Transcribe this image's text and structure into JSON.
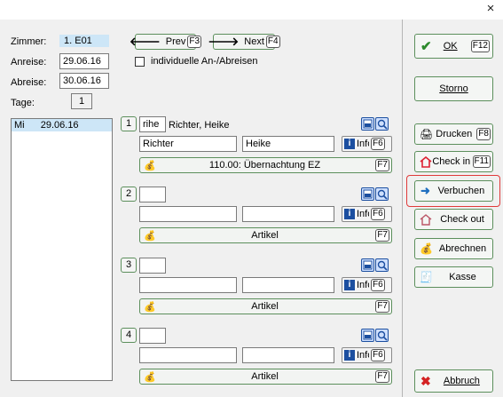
{
  "window": {
    "close_glyph": "×"
  },
  "header": {
    "zimmer_label": "Zimmer:",
    "zimmer_value": "1. E01",
    "anreise_label": "Anreise:",
    "anreise_value": "29.06.16",
    "abreise_label": "Abreise:",
    "abreise_value": "30.06.16",
    "tage_label": "Tage:",
    "tage_value": "1",
    "prev_label": "Prev",
    "prev_key": "F3",
    "next_label": "Next",
    "next_key": "F4",
    "individual_label": "individuelle An-/Abreisen"
  },
  "day_list": [
    {
      "day": "Mi",
      "date": "29.06.16"
    }
  ],
  "guests": [
    {
      "num": "1",
      "short": "rihe",
      "display": "Richter, Heike",
      "last": "Richter",
      "first": "Heike",
      "info_label": "Info",
      "info_key": "F6",
      "article": "110.00: Übernachtung EZ",
      "article_key": "F7"
    },
    {
      "num": "2",
      "short": "",
      "display": "",
      "last": "",
      "first": "",
      "info_label": "Info",
      "info_key": "F6",
      "article": "Artikel",
      "article_key": "F7"
    },
    {
      "num": "3",
      "short": "",
      "display": "",
      "last": "",
      "first": "",
      "info_label": "Info",
      "info_key": "F6",
      "article": "Artikel",
      "article_key": "F7"
    },
    {
      "num": "4",
      "short": "",
      "display": "",
      "last": "",
      "first": "",
      "info_label": "Info",
      "info_key": "F6",
      "article": "Artikel",
      "article_key": "F7"
    }
  ],
  "actions": {
    "ok_label": "OK",
    "ok_key": "F12",
    "storno_label": "Storno",
    "drucken_label": "Drucken",
    "drucken_key": "F8",
    "checkin_label": "Check in",
    "checkin_key": "F11",
    "verbuchen_label": "Verbuchen",
    "checkout_label": "Check out",
    "abrechnen_label": "Abrechnen",
    "kasse_label": "Kasse",
    "abbruch_label": "Abbruch"
  },
  "colors": {
    "highlight": "#e03a3a",
    "selection": "#cde6f7",
    "accent_green": "#5c8f5c"
  }
}
